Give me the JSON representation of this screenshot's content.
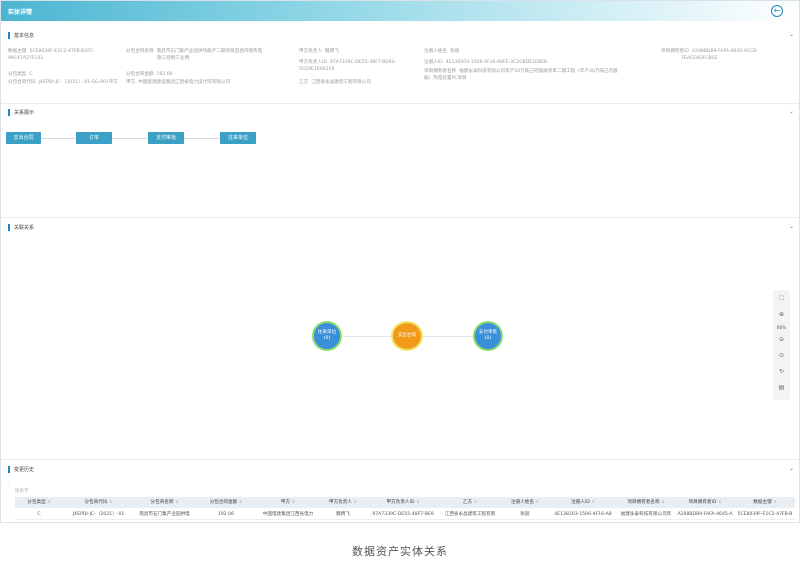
{
  "window": {
    "title": "实体详情"
  },
  "sections": {
    "basic": "基本信息",
    "relation_display": "关系展示",
    "associated": "关联关系",
    "change_history": "变更历史"
  },
  "basic_info": [
    {
      "k": "数据主键",
      "v": "5CE8039F-E1C2-47FB-B2FC-",
      "v2": "99C47A27F153"
    },
    {
      "k": "分包类型",
      "v": "C"
    },
    {
      "k": "分包合同代码",
      "v": "JXEPDI-JC-（2021）-01-SG-001平方"
    },
    {
      "k": "分包合同名称",
      "v": "南昌市石门集产业园供热能产二期项目直径内燃热电",
      "v2": "施工控制工业用"
    },
    {
      "k": "分包合同金额",
      "v": "192.06"
    },
    {
      "k": "甲方",
      "v": "中国能源建设集团江西省电力设计院有限公司"
    },
    {
      "k": "甲方负责人",
      "v": "魏明飞"
    },
    {
      "k": "甲方负责人ID",
      "v": "97A7339C-DE55-48F7-BE93-",
      "v2": "5CE9E16A61F8"
    },
    {
      "k": "乙方",
      "v": "江西省永晶建筑工程有限公司"
    },
    {
      "k": "注册人姓名",
      "v": "张丽"
    },
    {
      "k": "注册人ID",
      "v": "4E138303-1506-4F16-A8FE-3C2CBDE1EBEB"
    },
    {
      "k": "项目拥有者名称",
      "v": "福建永泰科技有限公司年产50万吨己内酰胺项目二期工程（年产30万吨己内酰",
      "v2": "胺）热电装置PC项目"
    },
    {
      "k": "项目拥有者ID",
      "v": "A298BDB9-FAFA-4645-ACCB-",
      "v2": "7EACEADFCBCE"
    }
  ],
  "flow_nodes": [
    "支出合同",
    "订单",
    "支付审批",
    "往来单位"
  ],
  "graph_nodes": [
    {
      "label": "往来单位",
      "count": "(0)"
    },
    {
      "label": "支出合同",
      "count": ""
    },
    {
      "label": "支付审批",
      "count": "(0)"
    }
  ],
  "toolbar": {
    "fit": "⛶",
    "zoom_in": "⊕",
    "zoom_level": "80%",
    "zoom_out": "⊖",
    "download": "⊙",
    "refresh": "↻",
    "export": "▤"
  },
  "table": {
    "search_placeholder": "搜索字",
    "columns": [
      "分包类型",
      "分包商代码",
      "分包商名称",
      "分包合同金额",
      "甲方",
      "甲方负责人",
      "甲方负责人ID",
      "乙方",
      "注册人姓名",
      "注册人ID",
      "项目拥有者名称",
      "项目拥有者ID",
      "数据主键"
    ],
    "rows": [
      [
        "C",
        "JXEPDI-JC-（2021）-01",
        "南昌市石门集产业园供电",
        "192.06",
        "中国电建集团江西省电力",
        "魏明飞",
        "97A7339C-DE55-48F7-BE9",
        "江西省永晶建筑工程有限",
        "张丽",
        "4E138303-1506-4F16-A8",
        "福建永泰科技有限公司年",
        "A298BDB9-FAFA-4645-A",
        "5CE8039F-E1C2-47FB-B"
      ]
    ]
  },
  "caption": "数据资产实体关系"
}
